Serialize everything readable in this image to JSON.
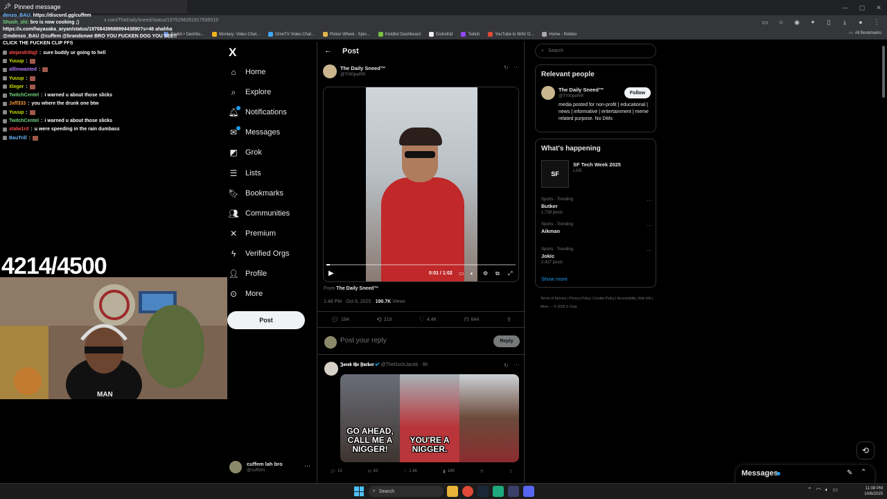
{
  "browser": {
    "url": "x.com/TheDailySneed/status/1975256291917595019",
    "bookmarks": [
      "Toolkit • Dashbo...",
      "Monkey: Video Chat...",
      "OmeTV Video Chat...",
      "Picker Wheel - Spin...",
      "KickBot Dashboard",
      "DistroKid",
      "Twitch",
      "YouTube to WAV D...",
      "Home - Roblox"
    ],
    "all_bookmarks": "All Bookmarks"
  },
  "chat": {
    "pinned_title": "Pinned message",
    "pinned_lines": [
      {
        "user": "denzo_BAU:",
        "text": "https://discord.gg/cuffem"
      },
      {
        "user": "Shush_shi:",
        "text": "bro is now cooking ;)"
      },
      {
        "user": "",
        "text": "https://x.com/hayasaka_aryan/status/1970843968899443890?s=46 ahahha"
      },
      {
        "user": "",
        "text": "@mdenzo_BAU @cuffem @brandonwe BRO YOU FUCKEN DOG YOU SEE!!"
      },
      {
        "user": "",
        "text": "CLICK THE FUCKEN CLIP FFS"
      }
    ],
    "messages": [
      {
        "user": "alejandr0lqjl",
        "color": "#ff4b4b",
        "text": "sure buddy ur going to hell",
        "emote": false
      },
      {
        "user": "Yuuup",
        "color": "#c8e000",
        "text": "",
        "emote": true
      },
      {
        "user": "alllmwanted",
        "color": "#b27bff",
        "text": "",
        "emote": true
      },
      {
        "user": "Yuuup",
        "color": "#c8e000",
        "text": "",
        "emote": true
      },
      {
        "user": "Xleger",
        "color": "#c8e000",
        "text": "",
        "emote": true
      },
      {
        "user": "TwitchCentel",
        "color": "#74d680",
        "text": "i warned u about those slicks",
        "emote": false
      },
      {
        "user": "Jxff333",
        "color": "#ff9a3c",
        "text": "you where the drunk one btw",
        "emote": false
      },
      {
        "user": "Yuuup",
        "color": "#c8e000",
        "text": "",
        "emote": true
      },
      {
        "user": "TwitchCentel",
        "color": "#74d680",
        "text": "i warned u about those slicks",
        "emote": false
      },
      {
        "user": "stalw1rd",
        "color": "#ff4b4b",
        "text": "u were speeding in the rain dumbass",
        "emote": false
      },
      {
        "user": "BauTrill",
        "color": "#6bb4ff",
        "text": "",
        "emote": true
      }
    ],
    "sub_counter": "4214/4500"
  },
  "xnav": {
    "logo": "X",
    "items": [
      {
        "label": "Home",
        "icon": "home-icon",
        "glyph": "⌂",
        "badge": false
      },
      {
        "label": "Explore",
        "icon": "search-icon",
        "glyph": "⌕",
        "badge": false
      },
      {
        "label": "Notifications",
        "icon": "bell-icon",
        "glyph": "🔔︎",
        "badge": true
      },
      {
        "label": "Messages",
        "icon": "envelope-icon",
        "glyph": "✉",
        "badge": true
      },
      {
        "label": "Grok",
        "icon": "grok-icon",
        "glyph": "◩",
        "badge": false
      },
      {
        "label": "Lists",
        "icon": "list-icon",
        "glyph": "☰",
        "badge": false
      },
      {
        "label": "Bookmarks",
        "icon": "bookmark-icon",
        "glyph": "🔖︎",
        "badge": false
      },
      {
        "label": "Communities",
        "icon": "people-icon",
        "glyph": "👥︎",
        "badge": false
      },
      {
        "label": "Premium",
        "icon": "x-icon",
        "glyph": "✕",
        "badge": false
      },
      {
        "label": "Verified Orgs",
        "icon": "lightning-icon",
        "glyph": "ϟ",
        "badge": false
      },
      {
        "label": "Profile",
        "icon": "user-icon",
        "glyph": "👤︎",
        "badge": false
      },
      {
        "label": "More",
        "icon": "more-circle-icon",
        "glyph": "⊙",
        "badge": false
      }
    ],
    "post_label": "Post",
    "account_name": "cuffem lah bro",
    "account_handle": "@cuff3m"
  },
  "post": {
    "header": "Post",
    "author_name": "The Daily Sneed™",
    "author_handle": "@Tr00peRR",
    "video_time": "0:01 / 1:02",
    "video_progress": 0.02,
    "from_label": "From",
    "from_name": "The Daily Sneed™",
    "timestamp": "1:48 PM · Oct 6, 2025 ·",
    "views_count": "190.7K",
    "views_label": "Views",
    "replies": "184",
    "reposts": "219",
    "likes": "4.4K",
    "bookmarks": "844",
    "reply_placeholder": "Post your reply",
    "reply_button": "Reply"
  },
  "reply": {
    "author_name": "𝕵𝖆𝖈𝖔𝖇 𝖙𝖍𝖊 𝕱𝖚𝖈𝖐𝖊𝖗",
    "author_handle": "@TheDuckJacob · 9h",
    "captions": [
      "GO AHEAD, CALL ME A NIGGER!",
      "YOU'RE A NIGGER.",
      ""
    ],
    "replies": "15",
    "reposts": "43",
    "likes": "1.4K",
    "views": "18K"
  },
  "right": {
    "search_placeholder": "Search",
    "relevant_title": "Relevant people",
    "rp_name": "The Daily Sneed™",
    "rp_handle": "@Tr00peRR",
    "rp_bio": "media posted for non-profit | educational | news | informative | entertainment | meme related purpose. No DMs",
    "follow_label": "Follow",
    "happening_title": "What's happening",
    "event_name": "SF Tech Week 2025",
    "event_status": "LIVE",
    "trends": [
      {
        "category": "Sports · Trending",
        "name": "Butker",
        "count": "1,739 posts"
      },
      {
        "category": "Sports · Trending",
        "name": "Aikman",
        "count": ""
      },
      {
        "category": "Sports · Trending",
        "name": "Jokic",
        "count": "2,427 posts"
      }
    ],
    "show_more": "Show more",
    "footer": "Terms of Service  |  Privacy Policy  |  Cookie Policy  |  Accessibility  |  Ads info  |  More ···  © 2025 X Corp.",
    "messages_label": "Messages"
  },
  "taskbar": {
    "search_label": "Search",
    "time": "11:08 PM",
    "date": "10/6/2025"
  }
}
